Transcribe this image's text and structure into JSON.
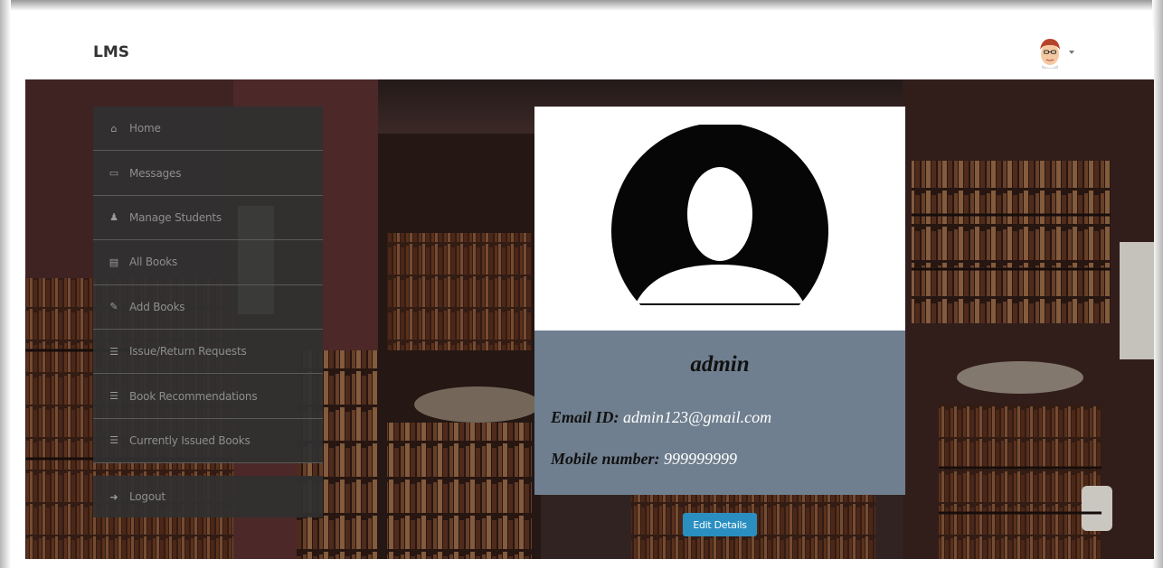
{
  "app": {
    "brand": "LMS"
  },
  "sidebar": {
    "items": [
      {
        "label": "Home",
        "icon": "home-icon",
        "glyph": "⌂"
      },
      {
        "label": "Messages",
        "icon": "inbox-icon",
        "glyph": "▭"
      },
      {
        "label": "Manage Students",
        "icon": "user-icon",
        "glyph": "♟"
      },
      {
        "label": "All Books",
        "icon": "book-icon",
        "glyph": "▤"
      },
      {
        "label": "Add Books",
        "icon": "edit-icon",
        "glyph": "✎"
      },
      {
        "label": "Issue/Return Requests",
        "icon": "list-alt-icon",
        "glyph": "☰"
      },
      {
        "label": "Book Recommendations",
        "icon": "list-icon",
        "glyph": "☰"
      },
      {
        "label": "Currently Issued Books",
        "icon": "list-icon",
        "glyph": "☰"
      }
    ],
    "logout": {
      "label": "Logout",
      "icon": "logout-icon",
      "glyph": "➜"
    }
  },
  "profile": {
    "username": "admin",
    "email_label": "Email ID:",
    "email": "admin123@gmail.com",
    "mobile_label": "Mobile number:",
    "mobile": "999999999",
    "edit_button": "Edit Details"
  },
  "colors": {
    "sidebar_bg": "#303030",
    "card_body_bg": "#6f7f8f",
    "button_bg": "#2a8fc0"
  }
}
